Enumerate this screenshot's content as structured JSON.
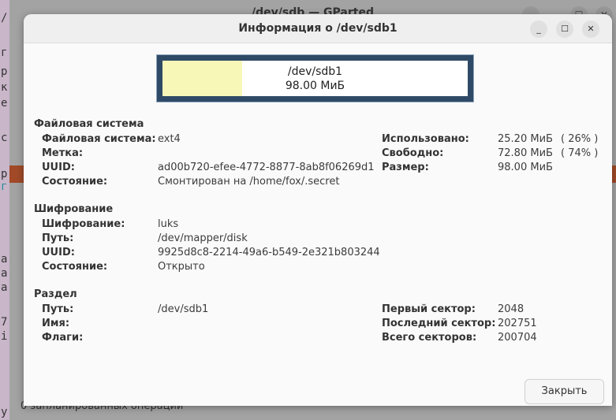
{
  "background_window": {
    "title": "/dev/sdb — GParted",
    "status": "0 запланированных операций",
    "side_chars": [
      "/",
      "г",
      "р",
      "к",
      "е",
      "с",
      "р",
      "г",
      "а",
      "а",
      "а",
      "7",
      "i",
      "у"
    ]
  },
  "dialog": {
    "title": "Информация о /dev/sdb1",
    "bar": {
      "name": "/dev/sdb1",
      "size": "98.00 МиБ",
      "used_fraction": 0.26,
      "used_color": "#f7f7b8",
      "border_color": "#2f4a66"
    },
    "filesystem": {
      "heading": "Файловая система",
      "rows": [
        {
          "label": "Файловая система:",
          "value": "ext4"
        },
        {
          "label": "Метка:",
          "value": ""
        },
        {
          "label": "UUID:",
          "value": "ad00b720-efee-4772-8877-8ab8f06269d1"
        },
        {
          "label": "Состояние:",
          "value": "Смонтирован на /home/fox/.secret"
        }
      ],
      "usage": [
        {
          "label": "Использовано:",
          "value": "25.20 МиБ",
          "pct": "( 26% )"
        },
        {
          "label": "Свободно:",
          "value": "72.80 МиБ",
          "pct": "( 74% )"
        },
        {
          "label": "Размер:",
          "value": "98.00 МиБ",
          "pct": ""
        }
      ]
    },
    "encryption": {
      "heading": "Шифрование",
      "rows": [
        {
          "label": "Шифрование:",
          "value": "luks"
        },
        {
          "label": "Путь:",
          "value": "/dev/mapper/disk"
        },
        {
          "label": "UUID:",
          "value": "9925d8c8-2214-49a6-b549-2e321b803244"
        },
        {
          "label": "Состояние:",
          "value": "Открыто"
        }
      ]
    },
    "partition": {
      "heading": "Раздел",
      "rows": [
        {
          "label": "Путь:",
          "value": "/dev/sdb1"
        },
        {
          "label": "Имя:",
          "value": ""
        },
        {
          "label": "Флаги:",
          "value": ""
        }
      ],
      "sectors": [
        {
          "label": "Первый сектор:",
          "value": "2048"
        },
        {
          "label": "Последний сектор:",
          "value": "202751"
        },
        {
          "label": "Всего секторов:",
          "value": "200704"
        }
      ]
    },
    "close_label": "Закрыть"
  }
}
